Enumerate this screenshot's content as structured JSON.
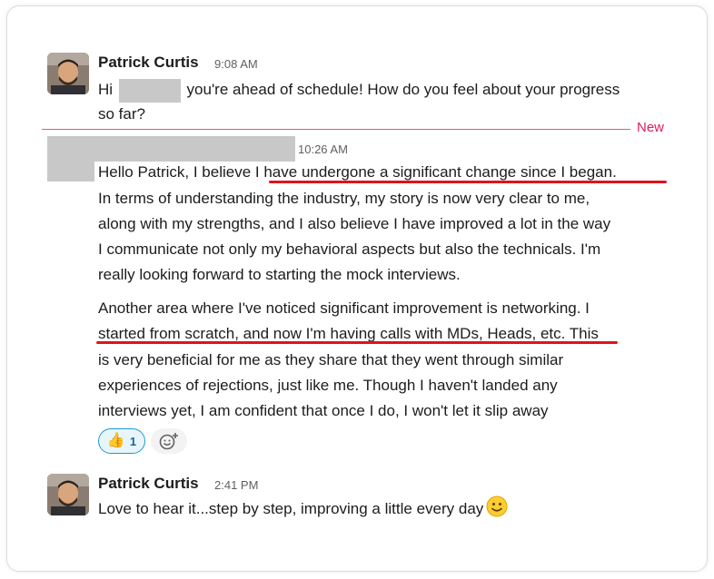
{
  "messages": [
    {
      "sender": "Patrick Curtis",
      "time": "9:08 AM",
      "line1_a": "Hi",
      "line1_b": "you're ahead of schedule! How do you feel about your progress",
      "line2": "so far?"
    },
    {
      "time": "10:26 AM",
      "p1": [
        "Hello Patrick, I believe I have undergone a significant change since I began.",
        "In terms of understanding the industry, my story is now very clear to me,",
        "along with my strengths, and I also believe I have improved a lot in the way",
        "I communicate not only my behavioral aspects but also the technicals. I'm",
        "really looking forward to starting the mock interviews."
      ],
      "p2": [
        "Another area where I've noticed significant improvement is networking. I",
        "started from scratch, and now I'm having calls with MDs, Heads, etc. This",
        "is very beneficial for me as they share that they went through similar",
        "experiences of rejections, just like me. Though I haven't landed any",
        "interviews yet, I am confident that once I do, I won't let it slip away"
      ],
      "reaction": {
        "emoji": "👍",
        "count": "1",
        "icon": "thumbs-up"
      }
    },
    {
      "sender": "Patrick Curtis",
      "time": "2:41 PM",
      "text": "Love to hear it...step by step, improving a little every day"
    }
  ],
  "divider_label": "New",
  "colors": {
    "new": "#e01e5a",
    "highlight_underline": "#e0121c",
    "reaction_border": "#1d9bd1"
  }
}
